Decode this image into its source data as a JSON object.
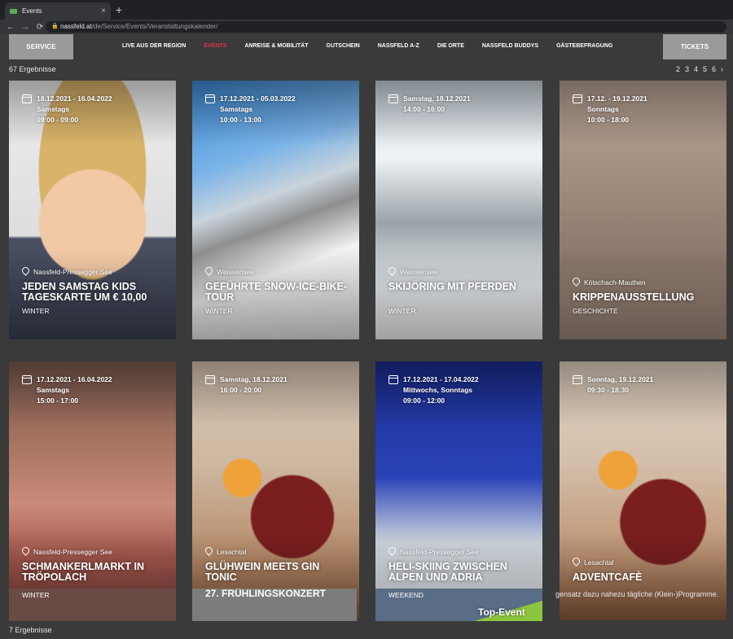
{
  "browser": {
    "tab_title": "Events",
    "tab_close": "×",
    "new_tab": "+",
    "back": "←",
    "forward": "→",
    "reload": "⟳",
    "url_host": "nassfeld.at",
    "url_path": "/de/Service/Events/Veranstaltungskalender/"
  },
  "header": {
    "service_label": "SERVICE",
    "tickets_label": "TICKETS",
    "nav": [
      {
        "label": "LIVE AUS DER REGION"
      },
      {
        "label": "EVENTS",
        "active": true
      },
      {
        "label": "ANREISE & MOBILITÄT"
      },
      {
        "label": "GUTSCHEIN"
      },
      {
        "label": "NASSFELD A-Z"
      },
      {
        "label": "DIE ORTE"
      },
      {
        "label": "NASSFELD BUDDYS"
      },
      {
        "label": "GÄSTEBEFRAGUNG"
      }
    ]
  },
  "results_count": "67 Ergebnisse",
  "results_count_bottom": "7 Ergebnisse",
  "pagination": [
    "2",
    "3",
    "4",
    "5",
    "6",
    "›"
  ],
  "cards": [
    {
      "date": "18.12.2021 - 16.04.2022",
      "days": "Samstags",
      "time": "09:00 - 09:00",
      "location": "Nassfeld-Pressegger See",
      "title": "JEDEN SAMSTAG KIDS TAGESKARTE UM € 10,00",
      "category": "WINTER"
    },
    {
      "date": "17.12.2021 - 05.03.2022",
      "days": "Samstags",
      "time": "10:00 - 13:00",
      "location": "Weissensee",
      "title": "GEFÜHRTE SNOW-ICE-BIKE-TOUR",
      "category": "WINTER"
    },
    {
      "date": "Samstag, 18.12.2021",
      "days": "14:00 - 16:00",
      "time": "",
      "location": "Weissensee",
      "title": "SKIJÖRING MIT PFERDEN",
      "category": "WINTER"
    },
    {
      "date": "17.12. - 19.12.2021",
      "days": "Sonntags",
      "time": "10:00 - 18:00",
      "location": "Kötschach-Mauthen",
      "title": "KRIPPENAUSSTELLUNG",
      "category": "GESCHICHTE"
    },
    {
      "date": "17.12.2021 - 16.04.2022",
      "days": "Samstags",
      "time": "15:00 - 17:00",
      "location": "Nassfeld-Pressegger See",
      "title": "SCHMANKERLMARKT IN TRÖPOLACH",
      "category": "WINTER"
    },
    {
      "date": "Samstag, 18.12.2021",
      "days": "16:00 - 20:00",
      "time": "",
      "location": "Lesachtal",
      "title": "GLÜHWEIN MEETS GIN TONIC",
      "category": ""
    },
    {
      "date": "17.12.2021 - 17.04.2022",
      "days": "Mittwochs, Sonntags",
      "time": "09:00 - 12:00",
      "location": "Nassfeld-Pressegger See",
      "title": "HELI-SKIING ZWISCHEN ALPEN UND ADRIA",
      "category": ""
    },
    {
      "date": "Sonntag, 19.12.2021",
      "days": "09:30 - 18:30",
      "time": "",
      "location": "Lesachtal",
      "title": "ADVENTCAFÈ",
      "category": ""
    }
  ],
  "bottom_row": {
    "strip1": "WINTER",
    "strip2": "27. FRÜHLINGSKONZERT",
    "strip3": "WEEKEND",
    "top_event": "Top-Event",
    "side_text": "gensatz dazu nahezu tägliche (Klein-)Programme."
  }
}
